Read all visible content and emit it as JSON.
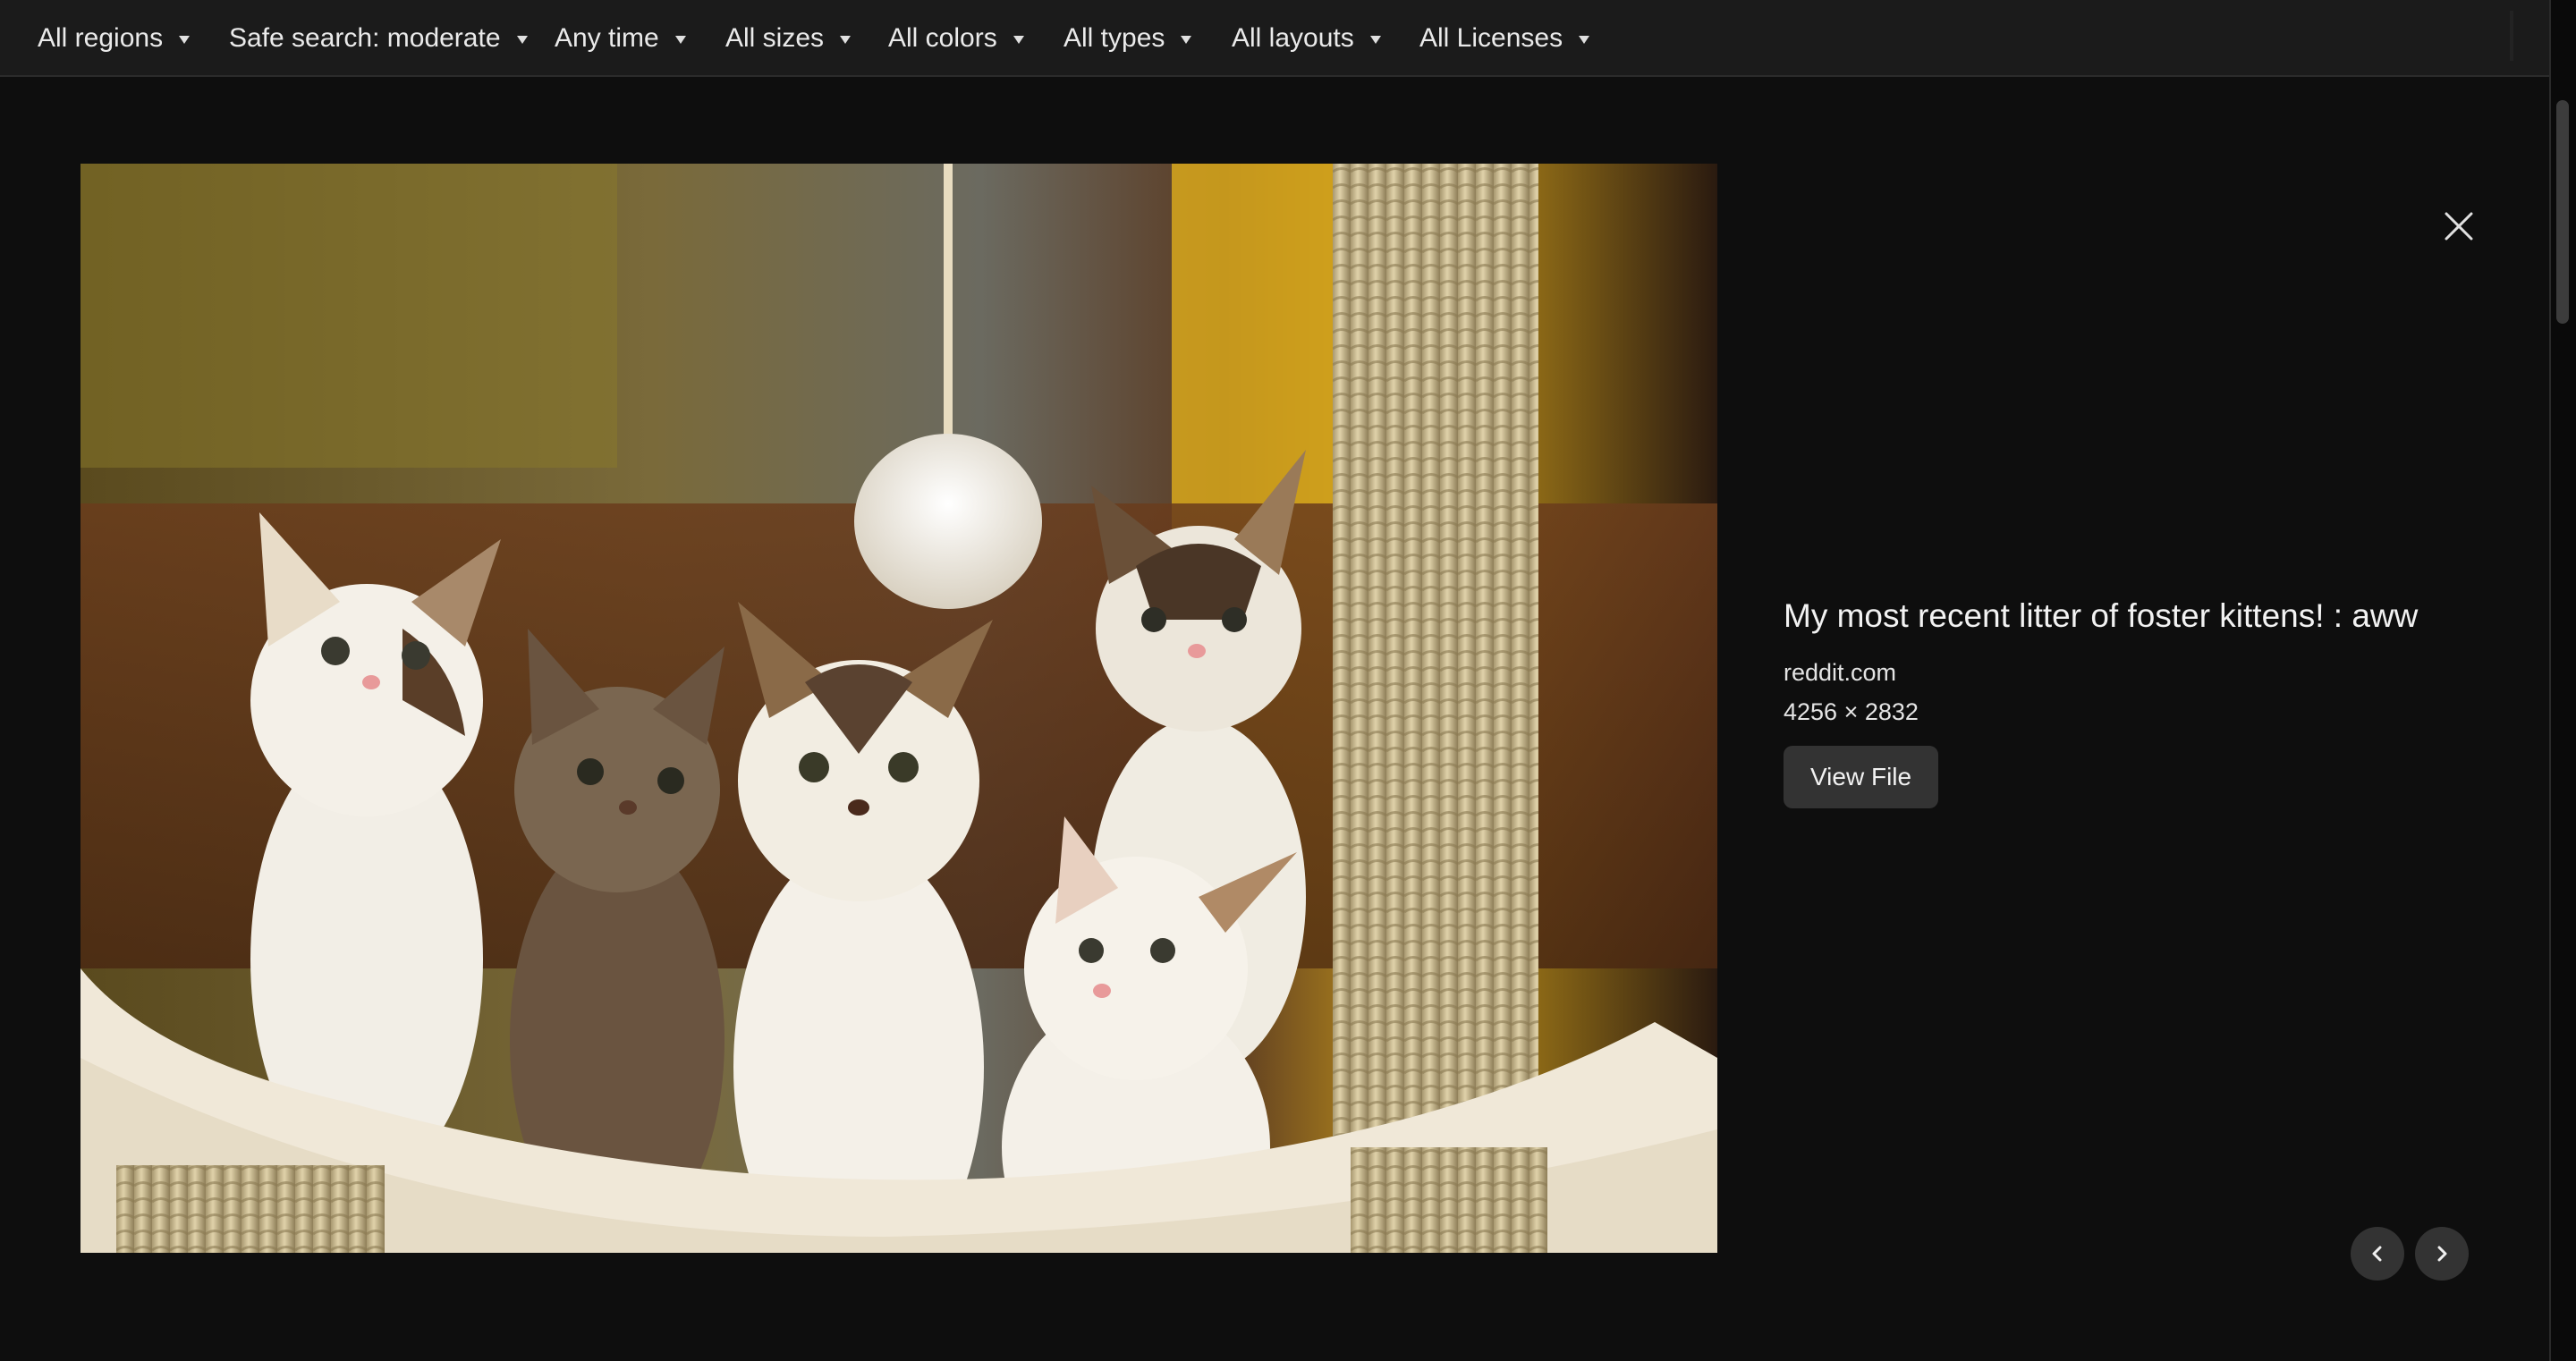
{
  "filters": [
    {
      "label": "All regions"
    },
    {
      "label": "Safe search: moderate"
    },
    {
      "label": "Any time"
    },
    {
      "label": "All sizes"
    },
    {
      "label": "All colors"
    },
    {
      "label": "All types"
    },
    {
      "label": "All layouts"
    },
    {
      "label": "All Licenses"
    }
  ],
  "preview": {
    "title": "My most recent litter of foster kittens! : aww",
    "source": "reddit.com",
    "dimensions": "4256 × 2832",
    "view_button": "View File"
  },
  "icons": {
    "close": "close-icon",
    "prev": "chevron-left-icon",
    "next": "chevron-right-icon",
    "filter_caret": "caret-down-icon"
  },
  "colors": {
    "background": "#0e0e0e",
    "filterbar": "#1b1b1b",
    "button": "#333333",
    "text": "#f2f2f2"
  }
}
